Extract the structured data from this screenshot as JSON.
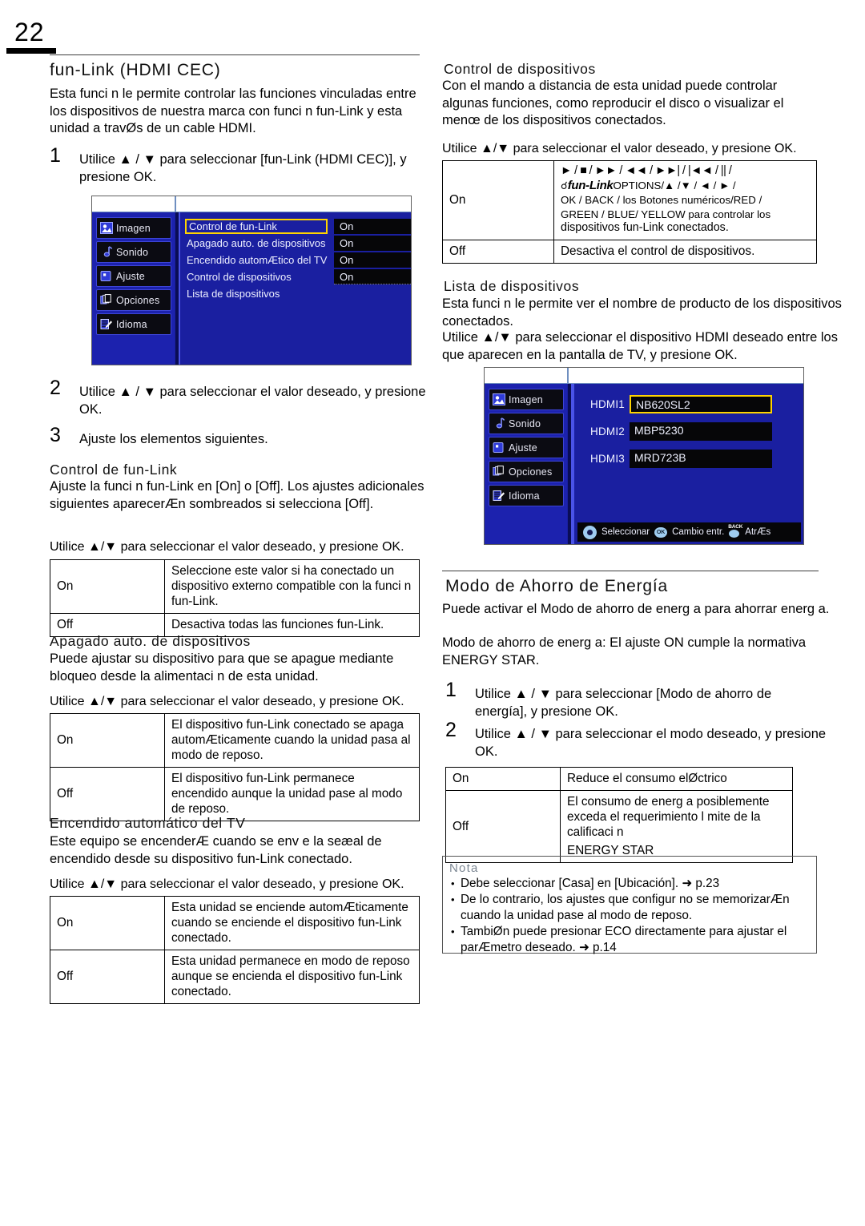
{
  "page": {
    "number": "22"
  },
  "left": {
    "section_title": "fun-Link (HDMI CEC)",
    "intro": "Esta funci n le permite controlar las funciones vinculadas entre los dispositivos de nuestra marca con funci n fun-Link y esta unidad a travØs de un cable HDMI.",
    "step1": {
      "num": "1",
      "text": "Utilice ▲ / ▼  para seleccionar [fun-Link (HDMI CEC)], y presione OK."
    },
    "step2": {
      "num": "2",
      "text": "Utilice ▲ / ▼  para seleccionar el valor deseado, y presione OK."
    },
    "step3": {
      "num": "3",
      "text": "Ajuste los elementos siguientes."
    },
    "osd1": {
      "sidebar": [
        {
          "label": "Imagen",
          "icon": "picture-icon"
        },
        {
          "label": "Sonido",
          "icon": "sound-icon"
        },
        {
          "label": "Ajuste",
          "icon": "settings-icon"
        },
        {
          "label": "Opciones",
          "icon": "options-icon"
        },
        {
          "label": "Idioma",
          "icon": "language-icon"
        }
      ],
      "rows": [
        {
          "label": "Control de fun-Link",
          "value": "On",
          "selected": true
        },
        {
          "label": "Apagado auto. de dispositivos",
          "value": "On",
          "selected": false
        },
        {
          "label": "Encendido automÆtico del TV",
          "value": "On",
          "selected": false
        },
        {
          "label": "Control de dispositivos",
          "value": "On",
          "selected": false
        },
        {
          "label": "Lista de dispositivos",
          "value": "",
          "selected": false
        }
      ]
    },
    "sub1": {
      "title": "Control de fun-Link",
      "body": "Ajuste la funci n fun-Link en [On] o [Off]. Los ajustes adicionales siguientes aparecerÆn sombreados si selecciona [Off].",
      "lead": "Utilice ▲/▼ para seleccionar el valor deseado, y presione OK.",
      "table": [
        {
          "key": "On",
          "desc": "Seleccione este valor si ha conectado un dispositivo externo compatible con la funci n fun-Link."
        },
        {
          "key": "Off",
          "desc": "Desactiva todas las funciones fun-Link."
        }
      ]
    },
    "sub2": {
      "title": "Apagado auto. de dispositivos",
      "body": "Puede ajustar su dispositivo para que se apague mediante bloqueo desde la alimentaci n de esta unidad.",
      "lead": "Utilice ▲/▼ para seleccionar el valor deseado, y presione OK.",
      "table": [
        {
          "key": "On",
          "desc": "El dispositivo fun-Link conectado se apaga automÆticamente cuando la unidad pasa al modo de reposo."
        },
        {
          "key": "Off",
          "desc": "El dispositivo fun-Link permanece encendido aunque la unidad pase al modo de reposo."
        }
      ]
    },
    "sub3": {
      "title": "Encendido automático del TV",
      "body": "Este equipo se encenderÆ cuando se env e la seæal de encendido desde su dispositivo fun-Link conectado.",
      "lead": "Utilice ▲/▼ para seleccionar el valor deseado, y presione OK.",
      "table": [
        {
          "key": "On",
          "desc": "Esta unidad se enciende automÆticamente cuando se enciende el dispositivo fun-Link conectado."
        },
        {
          "key": "Off",
          "desc": "Esta unidad permanece en modo de reposo aunque se encienda el dispositivo fun-Link conectado."
        }
      ]
    }
  },
  "right": {
    "sub1": {
      "title": "Control de dispositivos",
      "body": "Con el mando a distancia de esta unidad puede controlar algunas funciones, como reproducir el disco o visualizar el menœ de los dispositivos conectados.",
      "lead": "Utilice ▲/▼ para seleccionar el valor deseado, y presione OK.",
      "table": {
        "on_key": "On",
        "on_line1": "► / ■ / ►► / ◄◄ / ►►| / |◄◄ / || /",
        "on_logo": "fun-Link",
        "on_line2_tail": "OPTIONS/▲ /▼ / ◄ / ► /",
        "on_line3": "OK / BACK / los Botones numéricos/RED /",
        "on_line4": "GREEN / BLUE/ YELLOW  para controlar los",
        "on_line5": "dispositivos fun-Link conectados.",
        "off_key": "Off",
        "off_desc": "Desactiva el control de dispositivos."
      }
    },
    "sub2": {
      "title": "Lista de dispositivos",
      "body": "Esta funci n le permite ver el nombre de producto de los dispositivos conectados.",
      "body2": "Utilice ▲/▼ para seleccionar el dispositivo HDMI deseado entre los que aparecen en la pantalla de TV, y presione OK."
    },
    "osd2": {
      "sidebar": [
        {
          "label": "Imagen",
          "icon": "picture-icon"
        },
        {
          "label": "Sonido",
          "icon": "sound-icon"
        },
        {
          "label": "Ajuste",
          "icon": "settings-icon"
        },
        {
          "label": "Opciones",
          "icon": "options-icon"
        },
        {
          "label": "Idioma",
          "icon": "language-icon"
        }
      ],
      "rows": [
        {
          "port": "HDMI1",
          "device": "NB620SL2",
          "selected": true
        },
        {
          "port": "HDMI2",
          "device": "MBP5230",
          "selected": false
        },
        {
          "port": "HDMI3",
          "device": "MRD723B",
          "selected": false
        }
      ],
      "footer": [
        {
          "icon": "dpad-icon",
          "label": "Seleccionar"
        },
        {
          "icon": "ok-icon",
          "label": "Cambio entr."
        },
        {
          "icon": "back-icon",
          "label": "AtrÆs"
        }
      ]
    },
    "section_title": "Modo de Ahorro de Energía",
    "energy_body": "Puede activar el Modo de ahorro de energ a para ahorrar energ a.",
    "energy_body2": "Modo de ahorro de energ a: El ajuste ON cumple la normativa ENERGY STAR.",
    "step1": {
      "num": "1",
      "text": "Utilice ▲ / ▼  para seleccionar [Modo de ahorro de energía], y presione OK."
    },
    "step2": {
      "num": "2",
      "text": "Utilice ▲ / ▼  para seleccionar el modo deseado, y presione OK."
    },
    "energy_table": [
      {
        "key": "On",
        "desc": "Reduce el consumo elØctrico"
      },
      {
        "key": "Off",
        "desc": "El consumo de energ a posiblemente exceda el requerimiento l mite de la calificaci n",
        "desc2": "ENERGY STAR"
      }
    ],
    "note": {
      "title": "Nota",
      "lines": [
        "Debe seleccionar [Casa] en [Ubicación]. ➜ p.23",
        "De lo contrario, los ajustes que configur  no se memorizarÆn",
        "cuando la unidad pase al modo de reposo.",
        "TambiØn puede presionar ECO directamente para ajustar el",
        "parÆmetro deseado. ➜ p.14"
      ]
    }
  }
}
